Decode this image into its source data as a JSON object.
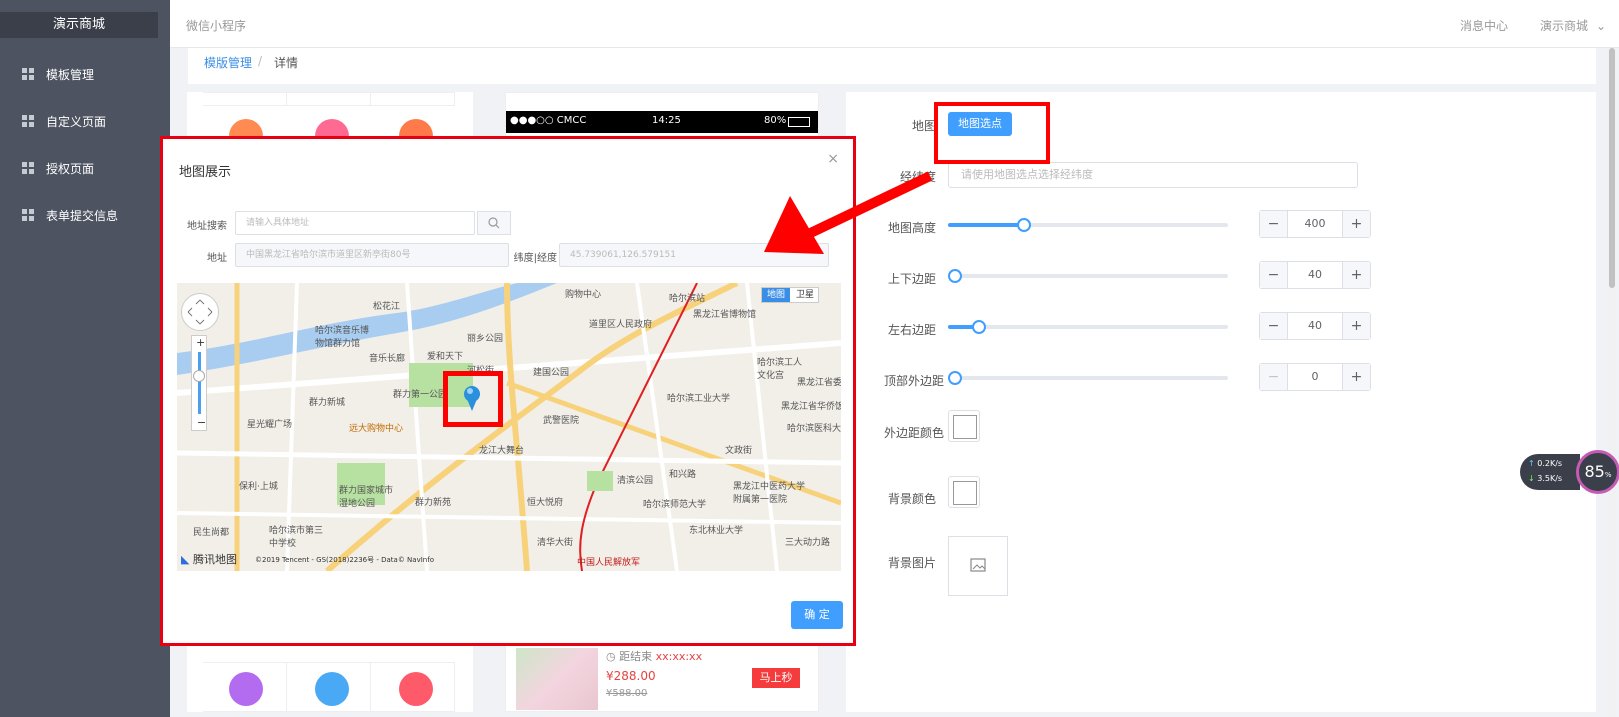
{
  "sidebar": {
    "brand": "演示商城",
    "items": [
      {
        "label": "模板管理"
      },
      {
        "label": "自定义页面"
      },
      {
        "label": "授权页面"
      },
      {
        "label": "表单提交信息"
      }
    ]
  },
  "topbar": {
    "left": "微信小程序",
    "messages": "消息中心",
    "user": "演示商城"
  },
  "breadcrumb": {
    "parent": "模版管理",
    "separator": "/",
    "current": "详情"
  },
  "phone": {
    "carrier": "●●●○○ CMCC",
    "time": "14:25",
    "battery": "80%",
    "product": {
      "countdown_label": "距结束",
      "countdown_value": "xx:xx:xx",
      "price": "¥288.00",
      "old_price": "¥588.00",
      "button": "马上秒"
    }
  },
  "settings": {
    "map_label": "地图",
    "map_button": "地图选点",
    "latlng_label": "经纬度",
    "latlng_placeholder": "请使用地图选点选择经纬度",
    "height_label": "地图高度",
    "height_value": "400",
    "height_fraction": 0.27,
    "tb_margin_label": "上下边距",
    "tb_margin_value": "40",
    "tb_fraction": 0.0,
    "lr_margin_label": "左右边距",
    "lr_margin_value": "40",
    "lr_fraction": 0.11,
    "top_margin_label": "顶部外边距",
    "top_margin_value": "0",
    "top_fraction": 0.0,
    "outer_color_label": "外边距颜色",
    "bg_color_label": "背景颜色",
    "bg_image_label": "背景图片"
  },
  "dialog": {
    "title": "地图展示",
    "search_label": "地址搜索",
    "search_placeholder": "请输入具体地址",
    "address_label": "地址",
    "address_value": "中国黑龙江省哈尔滨市道里区新亭街80号",
    "latlng_label": "纬度|经度",
    "latlng_value": "45.739061,126.579151",
    "map_type_map": "地图",
    "map_type_satellite": "卫星",
    "map_brand": "腾讯地图",
    "copyright": "©2019 Tencent - GS(2018)2236号 - Data© NavInfo",
    "ok_button": "确 定",
    "places": [
      "松花江",
      "哈尔滨音乐博物馆群力馆",
      "音乐长廊",
      "丽乡公园",
      "爱和天下",
      "河松街",
      "群力新城",
      "群力第一公园",
      "星光耀广场",
      "远大购物中心",
      "龙江大舞台",
      "道里区人民政府",
      "哈尔滨站",
      "黑龙江省博物馆",
      "建国公园",
      "哈尔滨工业大学",
      "黑龙江省华侨饭店",
      "哈尔滨医科大学",
      "群力国家城市湿地公园",
      "群力新苑",
      "保利·上城",
      "恒大悦府",
      "清滨公园",
      "哈尔滨师范大学",
      "黑龙江中医药大学附属第一医院",
      "东北林业大学",
      "民生尚都",
      "哈尔滨市第三中学校",
      "清华大街",
      "中国人民解放军",
      "购物中心",
      "哈尔滨工人文化宫",
      "黑龙江省委",
      "武警医院",
      "三大动力路",
      "和兴路",
      "文政街"
    ]
  },
  "widget": {
    "up": "0.2K/s",
    "down": "3.5K/s",
    "percent": "85"
  },
  "colors": {
    "primary": "#409eff",
    "annotation_red": "#ff0000",
    "sidebar": "#4d5360"
  }
}
